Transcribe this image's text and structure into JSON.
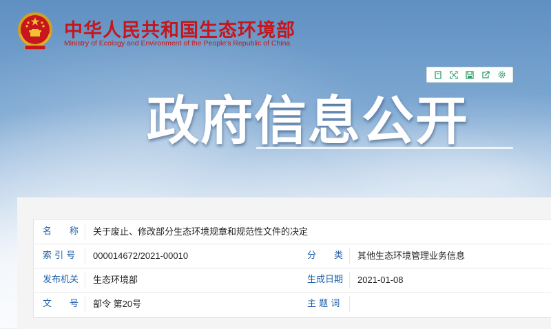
{
  "header": {
    "brand_cn": "中华人民共和国生态环境部",
    "brand_en": "Ministry of Ecology and Environment of the People's Republic of China",
    "emblem_icon": "national-emblem-icon"
  },
  "toolbar": {
    "icons": [
      "bookmark-icon",
      "fullscreen-icon",
      "save-icon",
      "share-icon",
      "settings-icon"
    ],
    "accent_color": "#2e9e6a"
  },
  "hero": {
    "title": "政府信息公开"
  },
  "info": {
    "name_label": "名　　称",
    "name_value": "关于废止、修改部分生态环境规章和规范性文件的决定",
    "index_label": "索 引 号",
    "index_value": "000014672/2021-00010",
    "category_label": "分　　类",
    "category_value": "其他生态环境管理业务信息",
    "issuer_label": "发布机关",
    "issuer_value": "生态环境部",
    "date_label": "生成日期",
    "date_value": "2021-01-08",
    "docno_label": "文　　号",
    "docno_value": "部令 第20号",
    "subject_label": "主 题 词",
    "subject_value": ""
  },
  "colors": {
    "brand_red": "#c4161c",
    "label_blue": "#1d5ea8"
  }
}
